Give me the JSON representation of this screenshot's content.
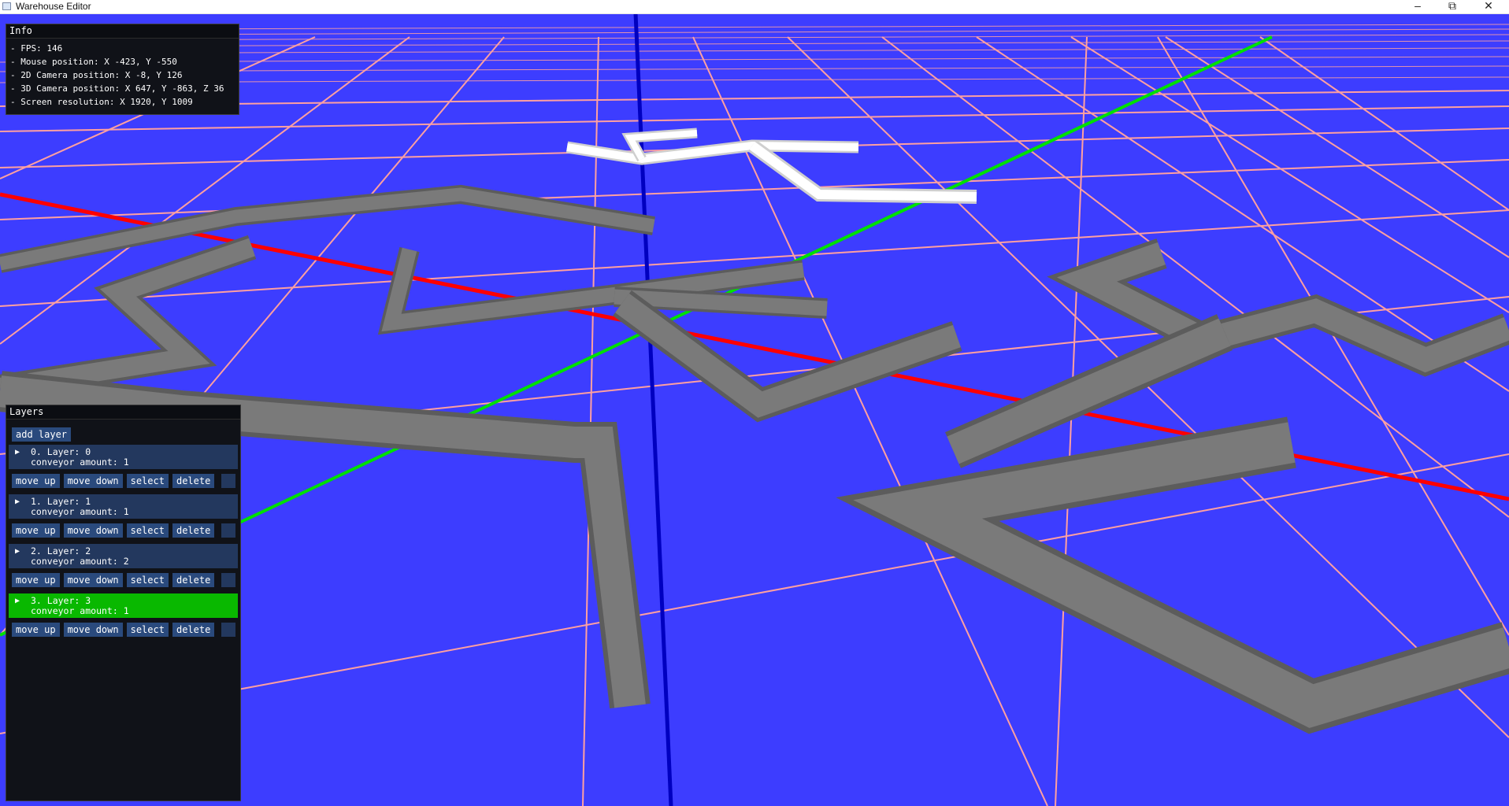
{
  "window": {
    "title": "Warehouse Editor"
  },
  "colors": {
    "ground": "#3d3dff",
    "grid_line": "#ffa0a0",
    "axis_x": "#ff0000",
    "axis_y": "#00e000",
    "axis_z": "#0000c0",
    "conveyor": "#7a7a7a",
    "conveyor_selected": "#ffffff",
    "panel_bg": "#101218",
    "button_bg": "#2a4a7d",
    "layer_header": "#23385e",
    "layer_selected": "#09b800"
  },
  "icons": {
    "minimize": "minimize-icon",
    "maximize": "maximize-icon",
    "close": "close-icon",
    "expand": "triangle-right-icon"
  },
  "info": {
    "title": "Info",
    "lines": [
      "- FPS: 146",
      "- Mouse position: X -423, Y -550",
      "- 2D Camera position: X -8, Y 126",
      "- 3D Camera position: X 647, Y -863, Z 36",
      "- Screen resolution: X 1920, Y 1009"
    ]
  },
  "layers": {
    "title": "Layers",
    "add_label": "add layer",
    "buttons": {
      "up": "move up",
      "down": "move down",
      "select": "select",
      "delete": "delete"
    },
    "items": [
      {
        "name": "0. Layer: 0",
        "conveyors": "conveyor amount: 1",
        "selected": false
      },
      {
        "name": "1. Layer: 1",
        "conveyors": "conveyor amount: 1",
        "selected": false
      },
      {
        "name": "2. Layer: 2",
        "conveyors": "conveyor amount: 2",
        "selected": false
      },
      {
        "name": "3. Layer: 3",
        "conveyors": "conveyor amount: 1",
        "selected": true
      }
    ]
  }
}
